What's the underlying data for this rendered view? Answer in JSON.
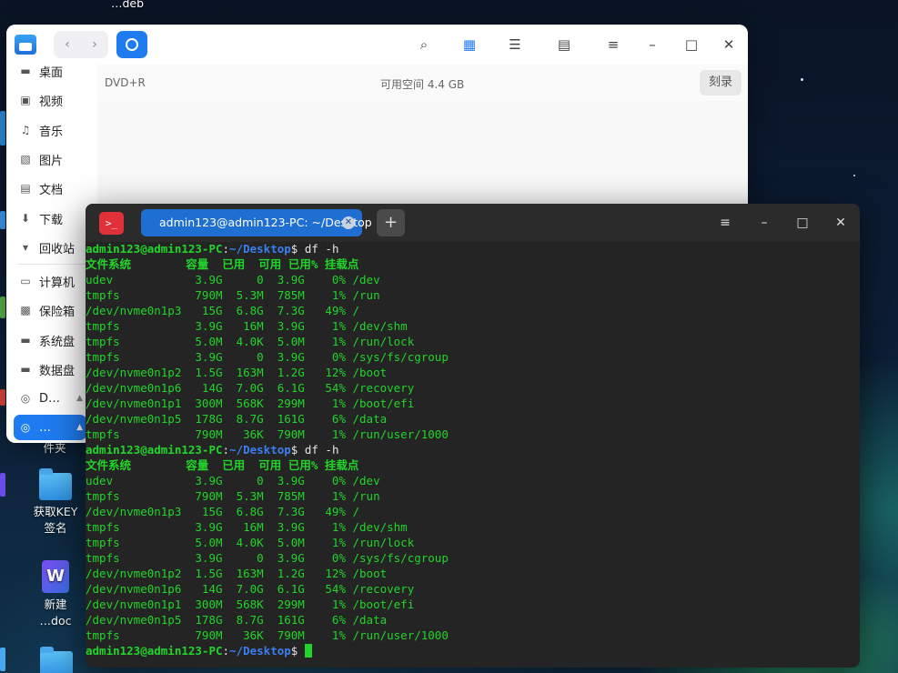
{
  "desktop": {
    "top_label": "…deb",
    "items": [
      {
        "label": "件夹"
      },
      {
        "label": "获取KEY\n签名"
      },
      {
        "label": "新建\n…doc"
      }
    ]
  },
  "file_manager": {
    "nav": {
      "back": "‹",
      "forward": "›"
    },
    "sidebar": [
      {
        "label": "桌面",
        "icon": "desktop-icon"
      },
      {
        "label": "视频",
        "icon": "video-icon"
      },
      {
        "label": "音乐",
        "icon": "music-icon"
      },
      {
        "label": "图片",
        "icon": "picture-icon"
      },
      {
        "label": "文档",
        "icon": "document-icon"
      },
      {
        "label": "下载",
        "icon": "download-icon"
      },
      {
        "label": "回收站",
        "icon": "trash-icon"
      },
      {
        "label": "计算机",
        "icon": "computer-icon"
      },
      {
        "label": "保险箱",
        "icon": "vault-icon"
      },
      {
        "label": "系统盘",
        "icon": "disk-icon"
      },
      {
        "label": "数据盘",
        "icon": "disk-icon"
      },
      {
        "label": "D…",
        "icon": "disc-icon"
      },
      {
        "label": "…",
        "icon": "disc-icon"
      }
    ],
    "disc_label": "DVD+R",
    "free_space": "可用空间 4.4 GB",
    "burn_button": "刻录"
  },
  "terminal": {
    "tab_title": "admin123@admin123-PC: ~/Desktop",
    "add_tab": "+",
    "logo": ">_",
    "prompt_user": "admin123@admin123-PC",
    "prompt_sep": ":",
    "prompt_path": "~/Desktop",
    "prompt_dollar": "$ ",
    "command": "df -h",
    "header": "文件系统        容量  已用  可用 已用% 挂载点",
    "rows": [
      "udev            3.9G     0  3.9G    0% /dev",
      "tmpfs           790M  5.3M  785M    1% /run",
      "/dev/nvme0n1p3   15G  6.8G  7.3G   49% /",
      "tmpfs           3.9G   16M  3.9G    1% /dev/shm",
      "tmpfs           5.0M  4.0K  5.0M    1% /run/lock",
      "tmpfs           3.9G     0  3.9G    0% /sys/fs/cgroup",
      "/dev/nvme0n1p2  1.5G  163M  1.2G   12% /boot",
      "/dev/nvme0n1p6   14G  7.0G  6.1G   54% /recovery",
      "/dev/nvme0n1p1  300M  568K  299M    1% /boot/efi",
      "/dev/nvme0n1p5  178G  8.7G  161G    6% /data",
      "tmpfs           790M   36K  790M    1% /run/user/1000"
    ]
  },
  "colors": {
    "accent": "#1f7cf0",
    "terminal_green": "#22d42a",
    "terminal_path": "#3a7ff0",
    "terminal_bg": "#242424"
  }
}
